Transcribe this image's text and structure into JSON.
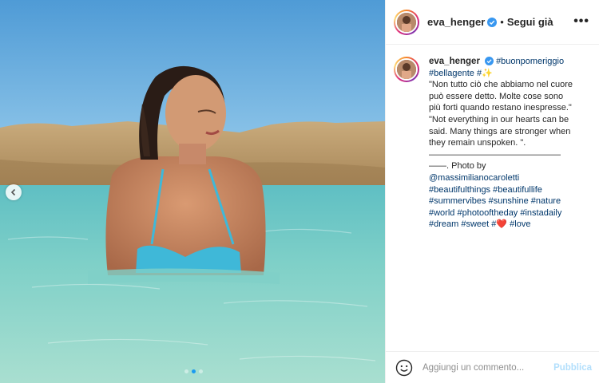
{
  "post": {
    "username": "eva_henger",
    "follow_label": "Segui già",
    "separator": "•",
    "more_label": "•••"
  },
  "caption": {
    "username": "eva_henger",
    "line1_tag": "#buonpomeriggio",
    "line2_tag": "#bellagente",
    "line2_hash": "#",
    "line2_emoji": "✨",
    "lines": [
      "\"Non tutto ciò che abbiamo nel cuore",
      "può essere detto. Molte cose sono",
      "più forti quando restano inespresse.\"",
      "\"Not everything in our hearts can be",
      "said. Many things are stronger when",
      "they remain unspoken. \".",
      "———————————————",
      "——. Photo by"
    ],
    "mention": "@massimilianocaroletti",
    "tag_lines": [
      "#beautifulthings #beautifullife",
      "#summervibes #sunshine #nature",
      "#world #photooftheday #instadaily",
      "#dream #sweet #"
    ],
    "heart_emoji": "❤️",
    "last_tag": "#love"
  },
  "comment": {
    "placeholder": "Aggiungi un commento...",
    "publish_label": "Pubblica"
  },
  "carousel": {
    "slides": 3,
    "active_index": 1
  },
  "colors": {
    "link": "#00376b",
    "verified": "#3897f0",
    "publish_disabled": "#b2dffc",
    "carousel_active": "#1a9bf0"
  },
  "icons": {
    "verified": "verified-badge-icon",
    "emoji": "emoji-smiley-icon",
    "prev": "chevron-left-icon",
    "more": "more-dots-icon"
  }
}
